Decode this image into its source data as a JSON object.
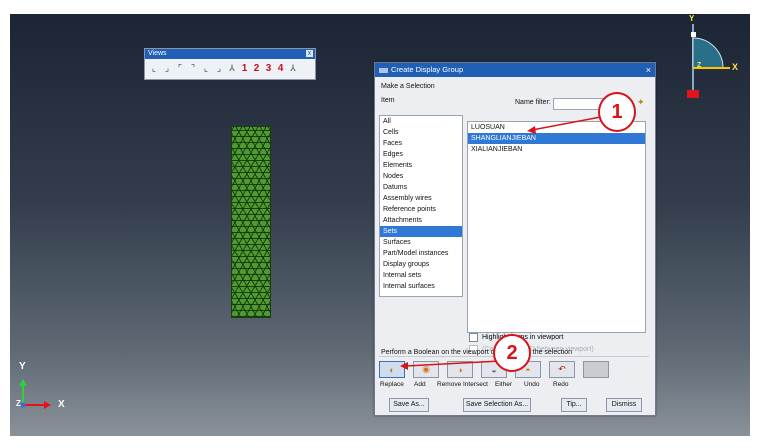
{
  "views_toolbar": {
    "title": "Views",
    "close": "x",
    "numbers": [
      "1",
      "2",
      "3",
      "4"
    ]
  },
  "compass": {
    "y_label": "Y",
    "x_label": "X",
    "z_label": "Z"
  },
  "triad": {
    "y_label": "Y",
    "x_label": "X",
    "z_label": "Z"
  },
  "dialog": {
    "title": "Create Display Group",
    "close": "×",
    "section_label": "Make a Selection",
    "item_header": "Item",
    "name_filter_label": "Name filter:",
    "name_filter_value": "",
    "items": [
      "All",
      "Cells",
      "Faces",
      "Edges",
      "Elements",
      "Nodes",
      "Datums",
      "Assembly wires",
      "Reference points",
      "Attachments",
      "Sets",
      "Surfaces",
      "Part/Model instances",
      "Display groups",
      "Internal sets",
      "Internal surfaces"
    ],
    "selected_item": "Sets",
    "sets": [
      "LUOSUAN",
      "SHANGLIANJIEBAN",
      "XIALIANJIEBAN"
    ],
    "selected_set": "SHANGLIANJIEBAN",
    "highlight_label": "Highlight items in viewport",
    "partial_label": "(Cause entire 3D between viewport)",
    "boolean_label": "Perform a Boolean on the viewport contents and the selection",
    "boolean_ops": [
      "Replace",
      "Add",
      "Remove",
      "Intersect",
      "Either",
      "Undo",
      "Redo"
    ],
    "buttons": {
      "save_as": "Save As...",
      "save_selection_as": "Save Selection As...",
      "tip": "Tip...",
      "dismiss": "Dismiss"
    }
  },
  "annotations": [
    "1",
    "2"
  ],
  "colors": {
    "accent": "#1f5fb6",
    "selection": "#2f78d6",
    "callout": "#d7141a",
    "mesh": "#4f9a31"
  }
}
